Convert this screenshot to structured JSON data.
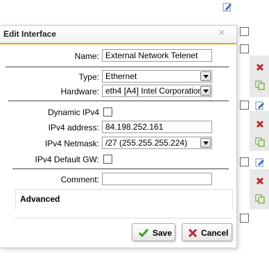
{
  "dialog": {
    "title": "Edit Interface",
    "close_glyph": "×",
    "fields": {
      "name": {
        "label": "Name:",
        "value": "External Network Telenet"
      },
      "type": {
        "label": "Type:",
        "value": "Ethernet"
      },
      "hardware": {
        "label": "Hardware:",
        "value": "eth4 [A4] Intel Corporation"
      },
      "dynamic_ipv4": {
        "label": "Dynamic IPv4",
        "checked": false
      },
      "ipv4_address": {
        "label": "IPv4 address:",
        "value": "84.198.252.161"
      },
      "ipv4_netmask": {
        "label": "IPv4 Netmask:",
        "value": "/27 (255.255.255.224)"
      },
      "ipv4_default_gw": {
        "label": "IPv4 Default GW:",
        "checked": false
      },
      "comment": {
        "label": "Comment:",
        "value": ""
      }
    },
    "advanced": {
      "title": "Advanced"
    },
    "buttons": {
      "save": {
        "label": "Save",
        "icon": "checkmark-icon",
        "color": "#3a9a1a"
      },
      "cancel": {
        "label": "Cancel",
        "icon": "cross-icon",
        "color": "#c0282a"
      }
    },
    "accent_color": "#f39c12"
  },
  "background": {
    "icons": [
      "edit-icon",
      "checkbox",
      "delete-icon",
      "copy-icon"
    ]
  }
}
